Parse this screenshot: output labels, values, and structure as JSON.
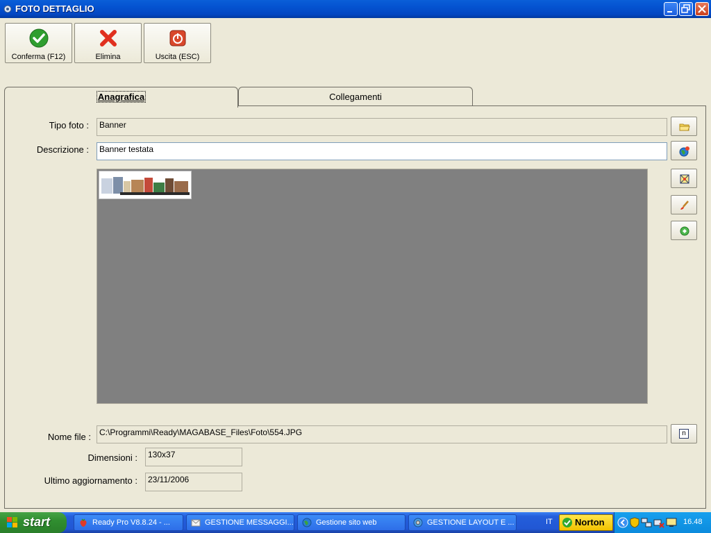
{
  "window": {
    "title": "FOTO DETTAGLIO"
  },
  "toolbar": {
    "confirm_label": "Conferma (F12)",
    "delete_label": "Elimina",
    "exit_label": "Uscita (ESC)"
  },
  "tabs": [
    {
      "label": "Anagrafica",
      "active": true
    },
    {
      "label": "Collegamenti",
      "active": false
    }
  ],
  "form": {
    "tipo_foto_label": "Tipo foto :",
    "tipo_foto_value": "Banner",
    "descrizione_label": "Descrizione :",
    "descrizione_value": "Banner testata",
    "nome_file_label": "Nome file :",
    "nome_file_value": "C:\\Programmi\\Ready\\MAGABASE_Files\\Foto\\554.JPG",
    "file_button_label": "n",
    "dimensioni_label": "Dimensioni :",
    "dimensioni_value": "130x37",
    "ultimo_label": "Ultimo aggiornamento :",
    "ultimo_value": "23/11/2006"
  },
  "side_buttons": [
    "folder-icon",
    "globe-icon",
    "resize-icon",
    "brush-icon",
    "recycle-icon"
  ],
  "taskbar": {
    "start_label": "start",
    "tasks": [
      {
        "label": "Ready Pro V8.8.24 - ..."
      },
      {
        "label": "GESTIONE MESSAGGI..."
      },
      {
        "label": "Gestione sito web"
      },
      {
        "label": "GESTIONE LAYOUT E ..."
      }
    ],
    "language": "IT",
    "norton_label": "Norton",
    "clock": "16.48"
  },
  "colors": {
    "window_bg": "#ece9d8",
    "titlebar": "#0452d0",
    "preview_bg": "#808080",
    "taskbar": "#245edb",
    "start": "#308e30",
    "tray": "#0c8bdd"
  }
}
